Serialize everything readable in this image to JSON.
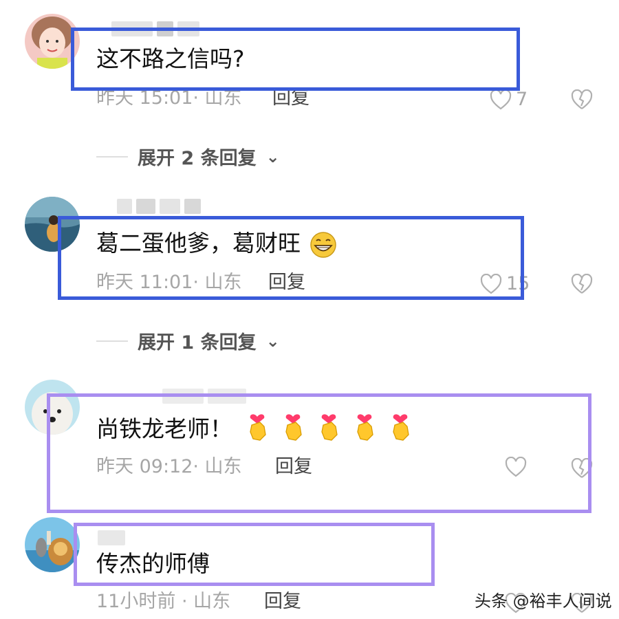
{
  "comments": [
    {
      "text": "这不路之信吗?",
      "meta": "昨天 15:01· 山东",
      "reply": "回复",
      "likes": "7",
      "expand": "展开 2 条回复"
    },
    {
      "text": "葛二蛋他爹，葛财旺",
      "meta": "昨天 11:01· 山东",
      "reply": "回复",
      "likes": "15",
      "expand": "展开 1 条回复"
    },
    {
      "text": "尚铁龙老师！",
      "meta": "昨天 09:12· 山东",
      "reply": "回复",
      "likes": ""
    },
    {
      "text": "传杰的师傅",
      "meta": "11小时前 · 山东",
      "reply": "回复"
    }
  ],
  "watermark": "头条 @裕丰人间说",
  "colors": {
    "frame_blue": "#3a5bd9",
    "frame_purple": "#a98ef0",
    "meta_gray": "#a6a6a6"
  }
}
